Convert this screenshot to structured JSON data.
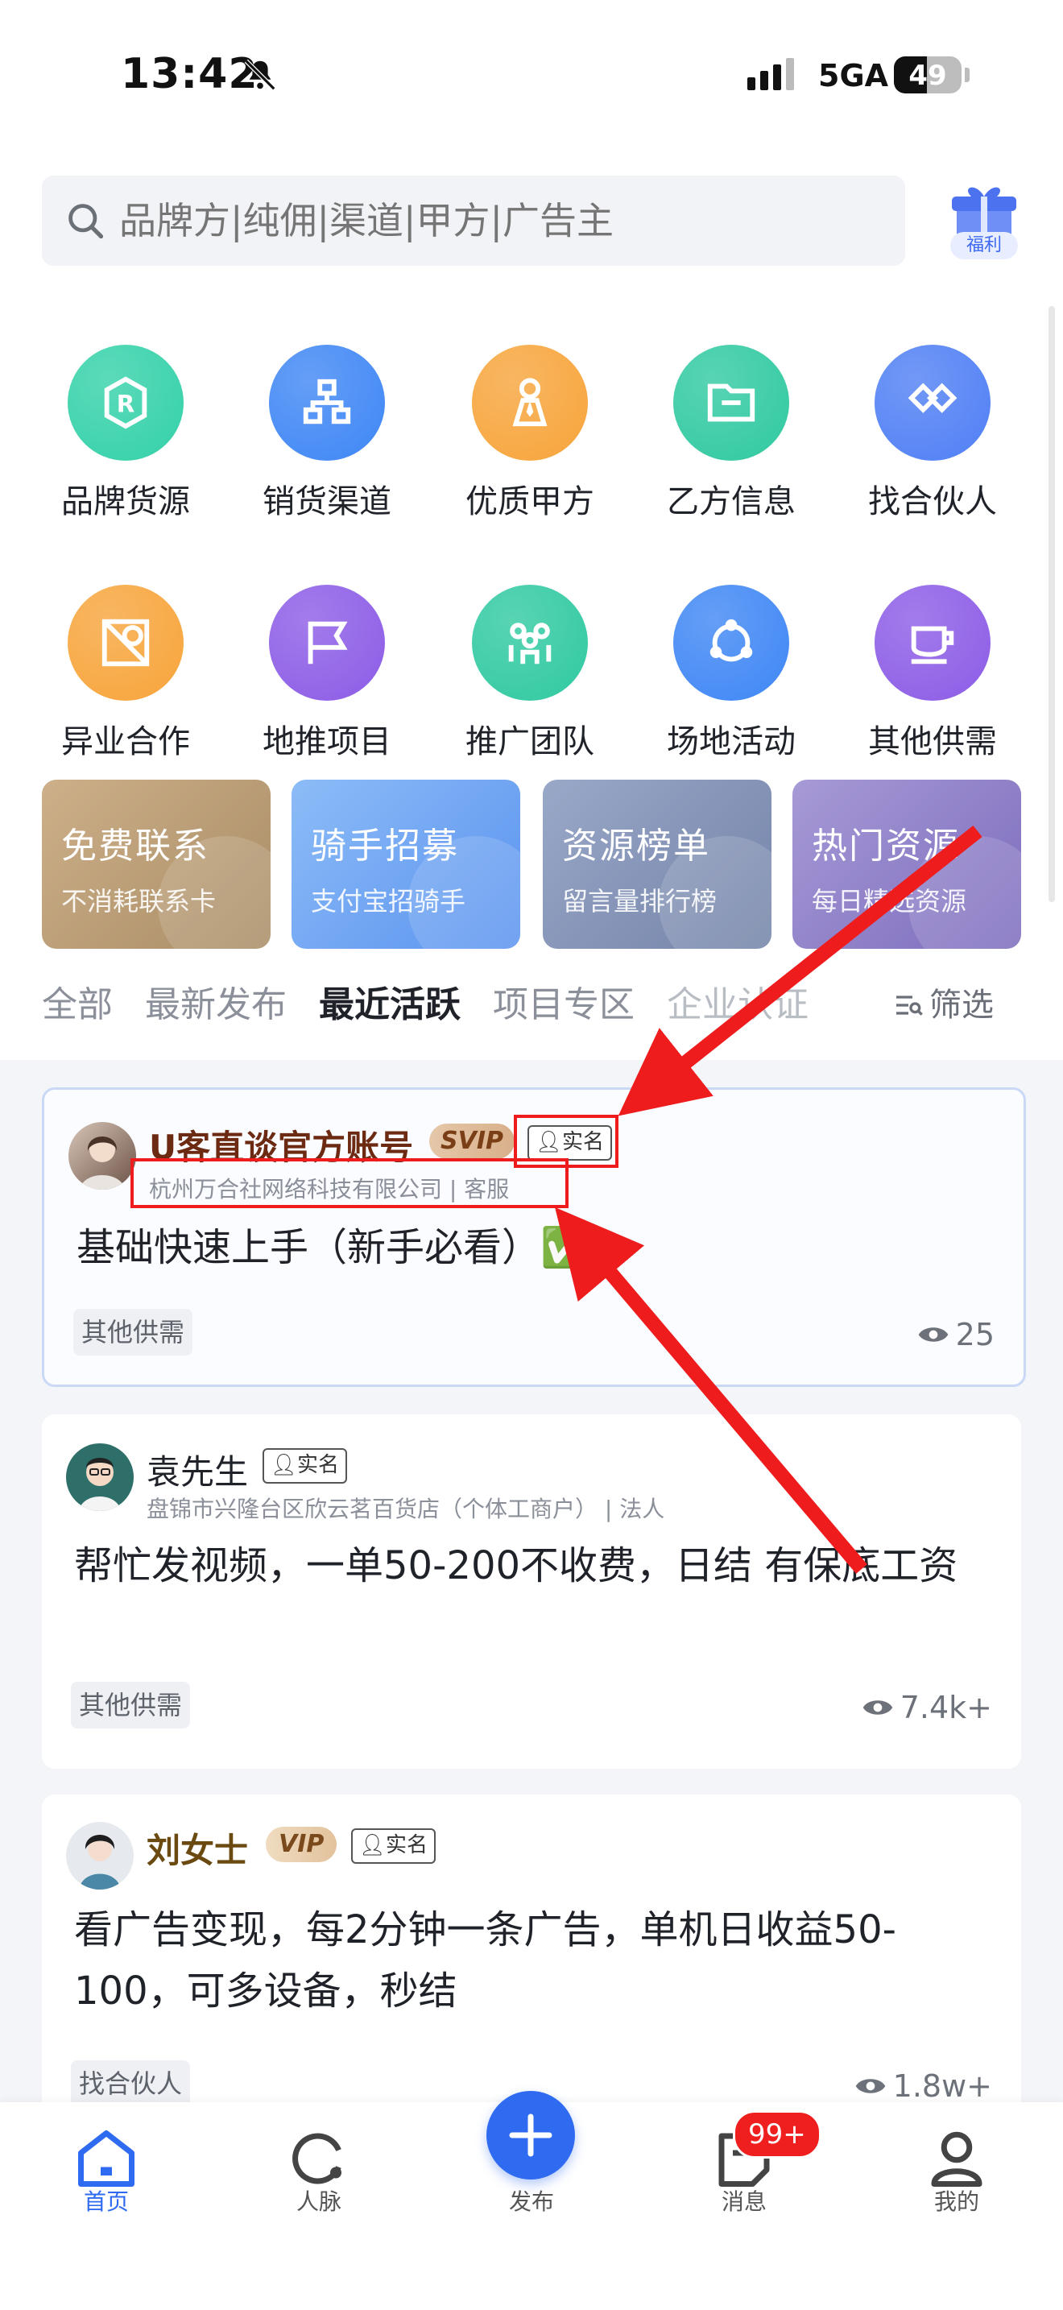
{
  "status_bar": {
    "time": "13:42",
    "network": "5GA",
    "battery": "49",
    "battery_level": 0.49
  },
  "search": {
    "placeholder": "品牌方|纯佣|渠道|甲方|广告主",
    "gift_label": "福利"
  },
  "categories": [
    {
      "label": "品牌货源",
      "icon": "brand-r-icon",
      "color": "#33d1a8"
    },
    {
      "label": "销货渠道",
      "icon": "org-chart-icon",
      "color": "#3e86f5"
    },
    {
      "label": "优质甲方",
      "icon": "person-tie-icon",
      "color": "#f7a43a"
    },
    {
      "label": "乙方信息",
      "icon": "folder-icon",
      "color": "#2fc9a0"
    },
    {
      "label": "找合伙人",
      "icon": "handshake-icon",
      "color": "#4f7ff5"
    },
    {
      "label": "异业合作",
      "icon": "shapes-icon",
      "color": "#f7a43a"
    },
    {
      "label": "地推项目",
      "icon": "flag-icon",
      "color": "#8c5be6"
    },
    {
      "label": "推广团队",
      "icon": "team-icon",
      "color": "#2fc9a0"
    },
    {
      "label": "场地活动",
      "icon": "share-icon",
      "color": "#3e86f5"
    },
    {
      "label": "其他供需",
      "icon": "cup-icon",
      "color": "#8c5be6"
    }
  ],
  "promos": [
    {
      "title": "免费联系",
      "subtitle": "不消耗联系卡",
      "color_from": "#cdb089",
      "color_to": "#a98d66"
    },
    {
      "title": "骑手招募",
      "subtitle": "支付宝招骑手",
      "color_from": "#8cbcf7",
      "color_to": "#5b93ef"
    },
    {
      "title": "资源榜单",
      "subtitle": "留言量排行榜",
      "color_from": "#9aa8c8",
      "color_to": "#7383a8"
    },
    {
      "title": "热门资源",
      "subtitle": "每日精选资源",
      "color_from": "#a79ad6",
      "color_to": "#7d6cbd"
    }
  ],
  "tabs": [
    "全部",
    "最新发布",
    "最近活跃",
    "项目专区",
    "企业认证"
  ],
  "active_tab": "最近活跃",
  "filter_label": "筛选",
  "posts": [
    {
      "name": "U客直谈官方账号",
      "badge": "SVIP",
      "real_name": "实名",
      "company": "杭州万合社网络科技有限公司 | 客服",
      "title": "基础快速上手（新手必看）✅",
      "tag": "其他供需",
      "views": "25"
    },
    {
      "name": "袁先生",
      "badge": "",
      "real_name": "实名",
      "company": "盘锦市兴隆台区欣云茗百货店（个体工商户） | 法人",
      "title": "帮忙发视频，一单50-200不收费，日结 有保底工资",
      "tag": "其他供需",
      "views": "7.4k+"
    },
    {
      "name": "刘女士",
      "badge": "VIP",
      "real_name": "实名",
      "company": "",
      "title": "看广告变现，每2分钟一条广告，单机日收益50-100，可多设备，秒结",
      "tag": "找合伙人",
      "views": "1.8w+"
    }
  ],
  "bottom_nav": {
    "home": "首页",
    "network": "人脉",
    "publish": "发布",
    "messages": "消息",
    "messages_badge": "99+",
    "me": "我的"
  },
  "colors": {
    "accent": "#2f6bf0",
    "annotation": "#ee1c1c"
  }
}
